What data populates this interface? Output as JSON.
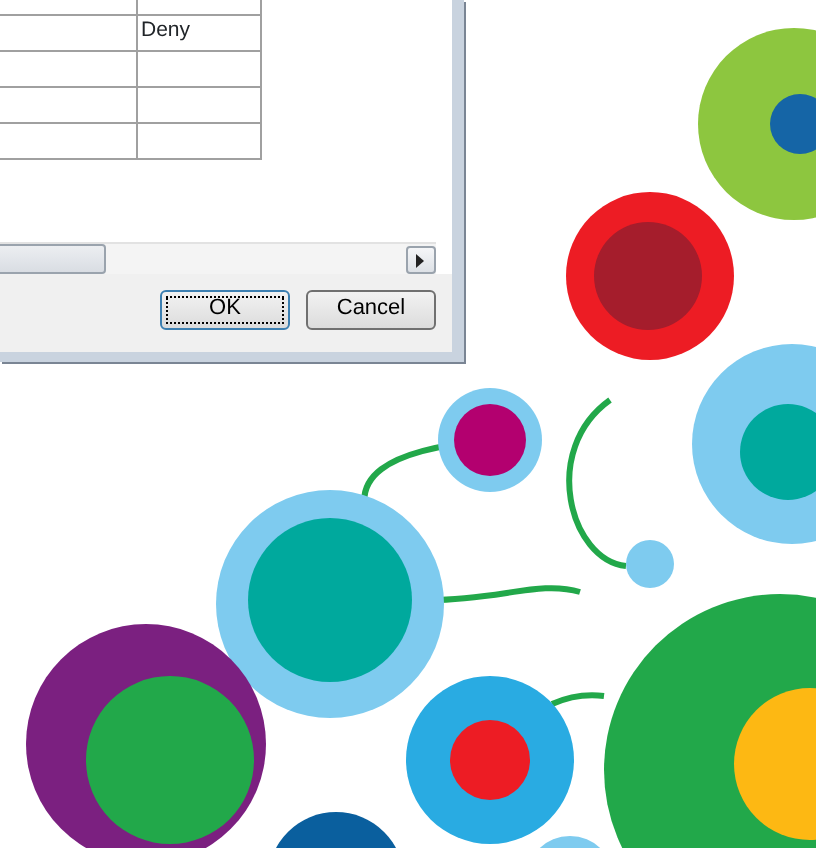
{
  "dialog": {
    "table": {
      "rows": [
        {},
        {
          "column_2": "Deny"
        },
        {},
        {},
        {}
      ]
    },
    "buttons": [
      {
        "label": "OK",
        "default": true
      },
      {
        "label": "Cancel",
        "default": false
      }
    ]
  }
}
